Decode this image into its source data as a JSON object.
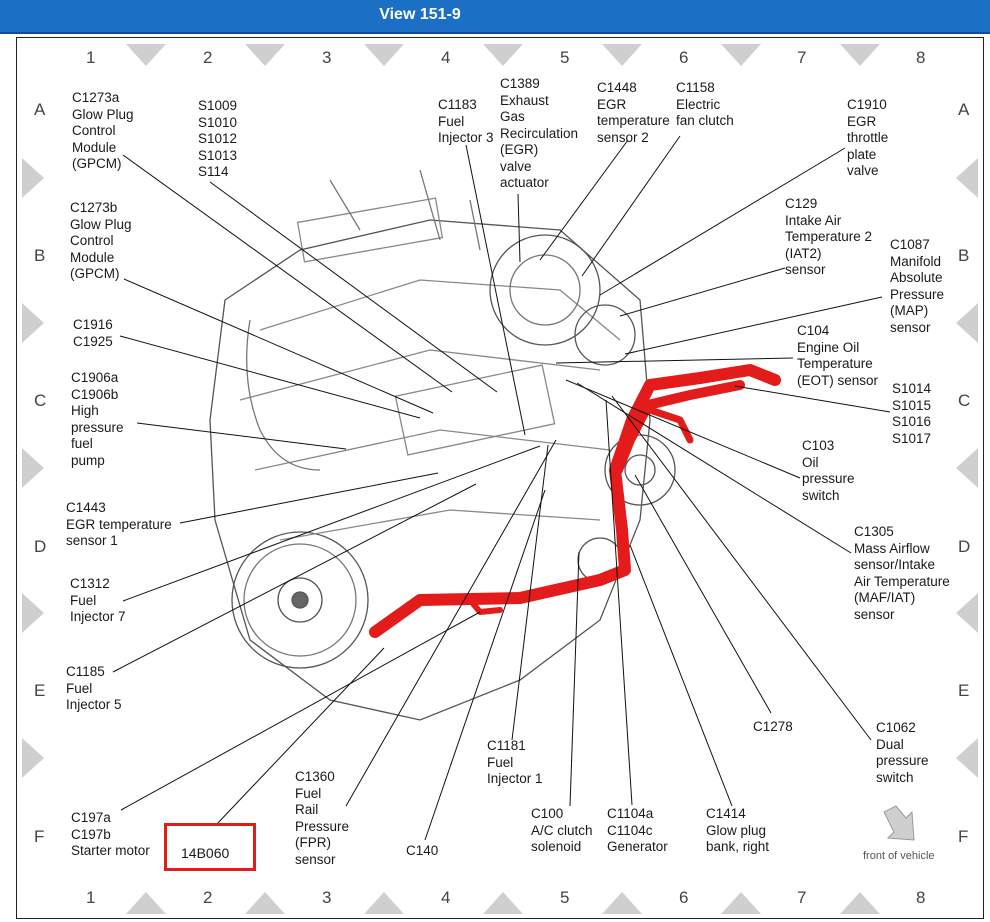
{
  "header": {
    "title": "View 151-9"
  },
  "grid": {
    "columns": [
      "1",
      "2",
      "3",
      "4",
      "5",
      "6",
      "7",
      "8"
    ],
    "rows": [
      "A",
      "B",
      "C",
      "D",
      "E",
      "F"
    ]
  },
  "callouts": {
    "c1273a": "C1273a\nGlow Plug\nControl\nModule\n(GPCM)",
    "s1009": "S1009\nS1010\nS1012\nS1013\nS114",
    "c1183": "C1183\nFuel\nInjector 3",
    "c1389": "C1389\nExhaust\nGas\nRecirculation\n(EGR)\nvalve\nactuator",
    "c1448": "C1448\nEGR\ntemperature\nsensor 2",
    "c1158": "C1158\nElectric\nfan clutch",
    "c1910": "C1910\nEGR\nthrottle\nplate\nvalve",
    "c1273b": "C1273b\nGlow Plug\nControl\nModule\n(GPCM)",
    "c129": "C129\nIntake Air\nTemperature 2\n(IAT2)\nsensor",
    "c1087": "C1087\nManifold\nAbsolute\nPressure\n(MAP)\nsensor",
    "c1916": "C1916\nC1925",
    "c104": "C104\nEngine Oil\nTemperature\n(EOT) sensor",
    "c1906": "C1906a\nC1906b\nHigh\npressure\nfuel\npump",
    "s1014": "S1014\nS1015\nS1016\nS1017",
    "c103": "C103\nOil\npressure\nswitch",
    "c1443": "C1443\nEGR temperature\nsensor 1",
    "c1305": "C1305\nMass Airflow\nsensor/Intake\nAir Temperature\n(MAF/IAT)\nsensor",
    "c1312": "C1312\nFuel\nInjector 7",
    "c1185": "C1185\nFuel\nInjector 5",
    "c1278": "C1278",
    "c1062": "C1062\nDual\npressure\nswitch",
    "c1181": "C1181\nFuel\nInjector 1",
    "c1360": "C1360\nFuel\nRail\nPressure\n(FPR)\nsensor",
    "c197": "C197a\nC197b\nStarter motor",
    "c140": "C140",
    "c100": "C100\nA/C clutch\nsolenoid",
    "c1104": "C1104a\nC1104c\nGenerator",
    "c1414": "C1414\nGlow plug\nbank, right"
  },
  "part_number": "14B060",
  "front_of_vehicle": "front of vehicle",
  "colors": {
    "header_bg": "#1b6fc4",
    "harness": "#e41b1b",
    "highlight_box": "#e41b1b"
  }
}
